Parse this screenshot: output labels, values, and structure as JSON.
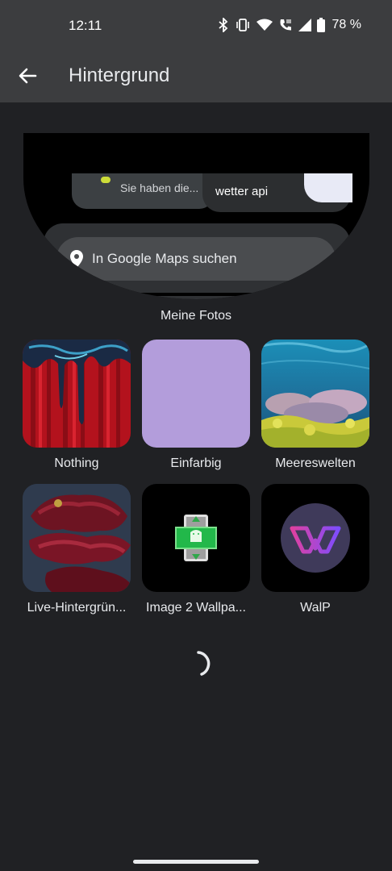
{
  "status_bar": {
    "time": "12:11",
    "battery": "78 %"
  },
  "app_bar": {
    "title": "Hintergrund"
  },
  "preview": {
    "chip_left_text": "Sie haben die...",
    "chip_right_text": "wetter api",
    "search_placeholder": "In Google Maps suchen",
    "quick_actions": [
      "home-icon",
      "work-icon",
      "restaurant-icon",
      "gas-station-icon"
    ]
  },
  "section": {
    "my_photos": "Meine Fotos"
  },
  "categories": [
    {
      "label": "Nothing"
    },
    {
      "label": "Einfarbig"
    },
    {
      "label": "Meereswelten"
    },
    {
      "label": "Live-Hintergrün..."
    },
    {
      "label": "Image 2 Wallpa..."
    },
    {
      "label": "WalP"
    }
  ],
  "colors": {
    "background": "#202124",
    "bar": "#3c3d3f",
    "solid_color_tile": "#b39ddb"
  }
}
